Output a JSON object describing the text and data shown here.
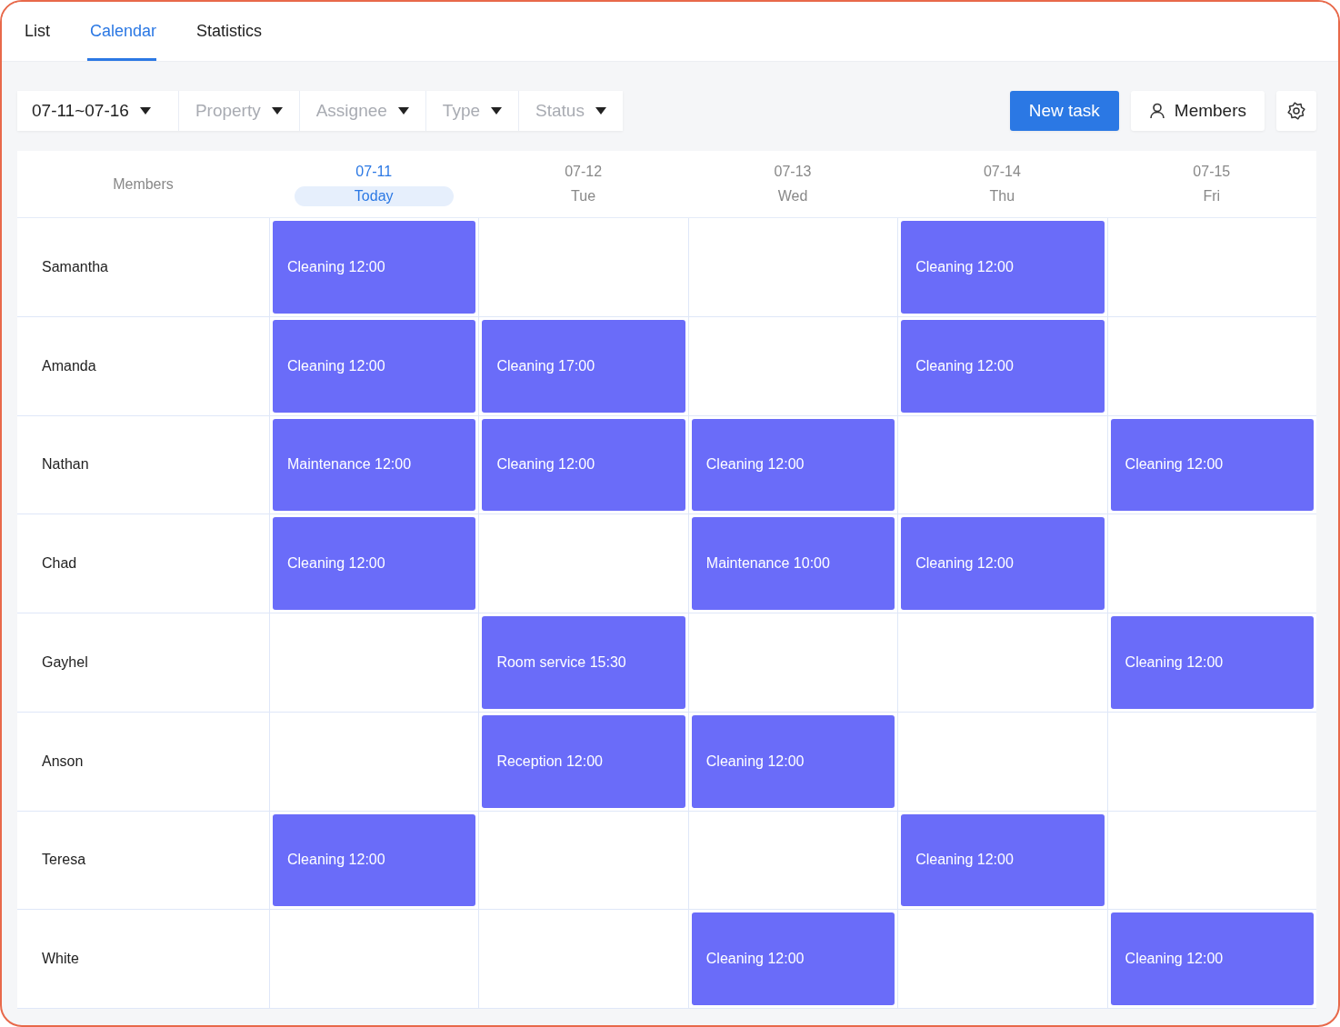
{
  "tabs": [
    {
      "label": "List",
      "selected": false
    },
    {
      "label": "Calendar",
      "selected": true
    },
    {
      "label": "Statistics",
      "selected": false
    }
  ],
  "filters": [
    {
      "label": "07-11~07-16",
      "filled": true
    },
    {
      "label": "Property",
      "filled": false
    },
    {
      "label": "Assignee",
      "filled": false
    },
    {
      "label": "Type",
      "filled": false
    },
    {
      "label": "Status",
      "filled": false
    }
  ],
  "actions": {
    "new_task": "New task",
    "members": "Members"
  },
  "calendar": {
    "members_header": "Members",
    "days": [
      {
        "date": "07-11",
        "weekday": "Today",
        "today": true
      },
      {
        "date": "07-12",
        "weekday": "Tue",
        "today": false
      },
      {
        "date": "07-13",
        "weekday": "Wed",
        "today": false
      },
      {
        "date": "07-14",
        "weekday": "Thu",
        "today": false
      },
      {
        "date": "07-15",
        "weekday": "Fri",
        "today": false
      }
    ],
    "rows": [
      {
        "member": "Samantha",
        "cells": [
          "Cleaning 12:00",
          null,
          null,
          "Cleaning 12:00",
          null
        ]
      },
      {
        "member": "Amanda",
        "cells": [
          "Cleaning 12:00",
          "Cleaning 17:00",
          null,
          "Cleaning 12:00",
          null
        ]
      },
      {
        "member": "Nathan",
        "cells": [
          "Maintenance 12:00",
          "Cleaning 12:00",
          "Cleaning 12:00",
          null,
          "Cleaning 12:00"
        ]
      },
      {
        "member": "Chad",
        "cells": [
          "Cleaning 12:00",
          null,
          "Maintenance 10:00",
          "Cleaning 12:00",
          null
        ]
      },
      {
        "member": "Gayhel",
        "cells": [
          null,
          "Room service 15:30",
          null,
          null,
          "Cleaning 12:00"
        ]
      },
      {
        "member": "Anson",
        "cells": [
          null,
          "Reception 12:00",
          "Cleaning 12:00",
          null,
          null
        ]
      },
      {
        "member": "Teresa",
        "cells": [
          "Cleaning 12:00",
          null,
          null,
          "Cleaning 12:00",
          null
        ]
      },
      {
        "member": "White",
        "cells": [
          null,
          null,
          "Cleaning 12:00",
          null,
          "Cleaning 12:00"
        ]
      }
    ]
  }
}
